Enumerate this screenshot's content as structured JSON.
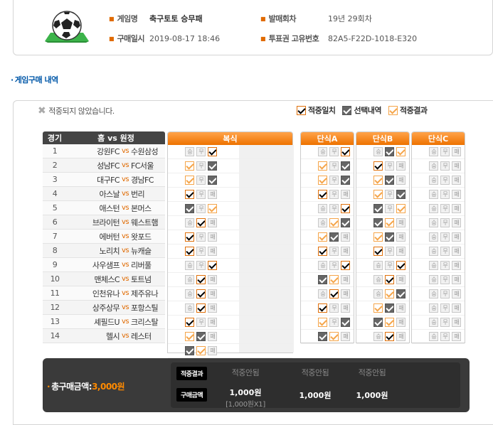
{
  "info": {
    "game_name_label": "게임명",
    "game_name": "축구토토 승무패",
    "round_label": "발매회차",
    "round": "19년 29회차",
    "purchase_date_label": "구매일시",
    "purchase_date": "2019-08-17 18:46",
    "ticket_id_label": "투표권 고유번호",
    "ticket_id": "82A5-F22D-1018-E320"
  },
  "section_title": "게임구매 내역",
  "status_text": "적중되지 않았습니다.",
  "legend": {
    "hit": "적중일치",
    "selected": "선택내역",
    "result": "적중결과"
  },
  "table": {
    "col_no": "경기",
    "col_teams": "홈 vs 원정",
    "vs": "vs"
  },
  "matches": [
    {
      "no": "1",
      "home": "강원FC",
      "away": "수원삼성"
    },
    {
      "no": "2",
      "home": "성남FC",
      "away": "FC서울"
    },
    {
      "no": "3",
      "home": "대구FC",
      "away": "경남FC"
    },
    {
      "no": "4",
      "home": "아스날",
      "away": "번리"
    },
    {
      "no": "5",
      "home": "애스턴",
      "away": "본머스"
    },
    {
      "no": "6",
      "home": "브라이턴",
      "away": "웨스트햄"
    },
    {
      "no": "7",
      "home": "에버턴",
      "away": "왓포드"
    },
    {
      "no": "8",
      "home": "노리치",
      "away": "뉴캐슬"
    },
    {
      "no": "9",
      "home": "사우샘프",
      "away": "리버풀"
    },
    {
      "no": "10",
      "home": "맨체스C",
      "away": "토트넘"
    },
    {
      "no": "11",
      "home": "인천유나",
      "away": "제주유나"
    },
    {
      "no": "12",
      "home": "상주상무",
      "away": "포항스틸"
    },
    {
      "no": "13",
      "home": "셰필드U",
      "away": "크리스탈"
    },
    {
      "no": "14",
      "home": "헬시",
      "away": "레스터"
    }
  ],
  "option_labels": [
    "승",
    "무",
    "패"
  ],
  "grids": {
    "bokshik": {
      "title": "복식",
      "rows": [
        [
          "",
          "",
          "hit"
        ],
        [
          "res",
          "",
          "sel"
        ],
        [
          "res",
          "",
          "sel"
        ],
        [
          "hit",
          "",
          ""
        ],
        [
          "sel",
          "",
          "res"
        ],
        [
          "",
          "hit",
          ""
        ],
        [
          "hit",
          "",
          ""
        ],
        [
          "hit",
          "",
          ""
        ],
        [
          "",
          "",
          "hit"
        ],
        [
          "",
          "hit",
          ""
        ],
        [
          "",
          "hit",
          ""
        ],
        [
          "",
          "hit",
          ""
        ],
        [
          "hit",
          "",
          ""
        ],
        [
          "res",
          "sel",
          ""
        ],
        [
          "sel",
          "res",
          ""
        ]
      ]
    },
    "a": {
      "title": "단식A",
      "rows": [
        [
          "",
          "",
          "hit"
        ],
        [
          "res",
          "",
          "sel"
        ],
        [
          "res",
          "",
          "sel"
        ],
        [
          "hit",
          "",
          ""
        ],
        [
          "",
          "",
          "hit"
        ],
        [
          "",
          "res",
          "sel"
        ],
        [
          "res",
          "sel",
          ""
        ],
        [
          "hit",
          "",
          ""
        ],
        [
          "",
          "",
          "hit"
        ],
        [
          "sel",
          "res",
          ""
        ],
        [
          "",
          "hit",
          ""
        ],
        [
          "hit",
          "",
          ""
        ],
        [
          "res",
          "",
          "sel"
        ],
        [
          "sel",
          "res",
          ""
        ]
      ]
    },
    "b": {
      "title": "단식B",
      "rows": [
        [
          "",
          "sel",
          "res"
        ],
        [
          "hit",
          "",
          ""
        ],
        [
          "res",
          "sel",
          ""
        ],
        [
          "res",
          "",
          "sel"
        ],
        [
          "sel",
          "",
          "res"
        ],
        [
          "sel",
          "res",
          ""
        ],
        [
          "res",
          "sel",
          ""
        ],
        [
          "hit",
          "",
          ""
        ],
        [
          "",
          "",
          "hit"
        ],
        [
          "",
          "hit",
          ""
        ],
        [
          "",
          "res",
          "sel"
        ],
        [
          "res",
          "sel",
          ""
        ],
        [
          "sel",
          "res",
          ""
        ],
        [
          "",
          "hit",
          ""
        ]
      ]
    },
    "c": {
      "title": "단식C",
      "rows": [
        [
          "",
          "",
          ""
        ],
        [
          "",
          "",
          ""
        ],
        [
          "",
          "",
          ""
        ],
        [
          "",
          "",
          ""
        ],
        [
          "",
          "",
          ""
        ],
        [
          "",
          "",
          ""
        ],
        [
          "",
          "",
          ""
        ],
        [
          "",
          "",
          ""
        ],
        [
          "",
          "",
          ""
        ],
        [
          "",
          "",
          ""
        ],
        [
          "",
          "",
          ""
        ],
        [
          "",
          "",
          ""
        ],
        [
          "",
          "",
          ""
        ],
        [
          "",
          "",
          ""
        ]
      ]
    }
  },
  "summary": {
    "total_label": "총구매금액:",
    "total_amount": "3,000원",
    "result_pill": "적중결과",
    "purchase_pill": "구매금액",
    "cols": [
      {
        "result": "적중안됨",
        "amount": "1,000원",
        "detail": "[1,000원X1]"
      },
      {
        "result": "적중안됨",
        "amount": "1,000원",
        "detail": ""
      },
      {
        "result": "적중안됨",
        "amount": "1,000원",
        "detail": ""
      }
    ]
  },
  "colors": {
    "accent": "#ee7200",
    "hit_border": "#e0700a",
    "selected_fill": "#666666",
    "result_border": "#f5a54a",
    "title_blue": "#0057a8"
  }
}
